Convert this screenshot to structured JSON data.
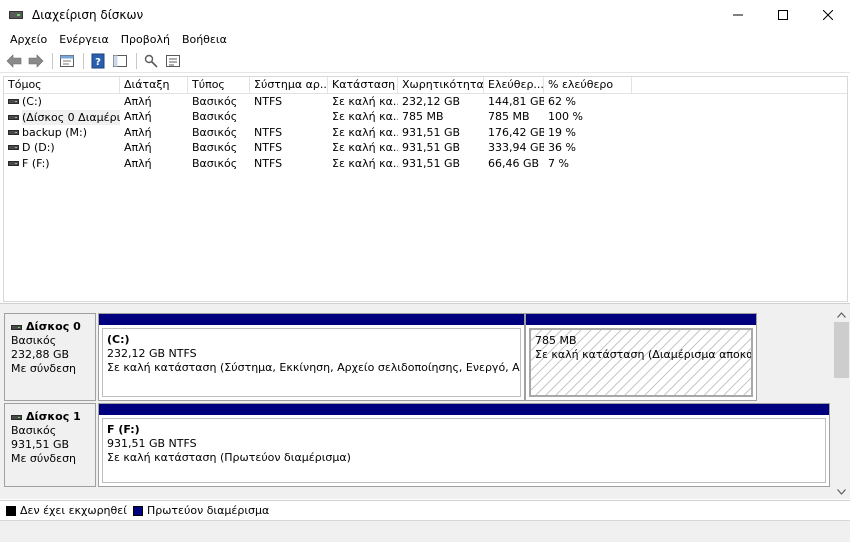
{
  "window": {
    "title": "Διαχείριση δίσκων"
  },
  "menu": [
    "Αρχείο",
    "Ενέργεια",
    "Προβολή",
    "Βοήθεια"
  ],
  "toolbar_icons": [
    "back-arrow-icon",
    "forward-arrow-icon",
    "properties-icon",
    "help-icon",
    "connect-icon",
    "settings-list-icon"
  ],
  "columns": [
    "Τόμος",
    "Διάταξη",
    "Τύπος",
    "Σύστημα αρ...",
    "Κατάσταση",
    "Χωρητικότητα",
    "Ελεύθερ...",
    "% ελεύθερο"
  ],
  "volumes": [
    {
      "name": "(C:)",
      "layout": "Απλή",
      "type": "Βασικός",
      "fs": "NTFS",
      "status": "Σε καλή κα...",
      "capacity": "232,12 GB",
      "free": "144,81 GB",
      "pct": "62 %"
    },
    {
      "name": "(Δίσκος 0 Διαμέρι...",
      "layout": "Απλή",
      "type": "Βασικός",
      "fs": "",
      "status": "Σε καλή κα...",
      "capacity": "785 MB",
      "free": "785 MB",
      "pct": "100 %"
    },
    {
      "name": "backup (M:)",
      "layout": "Απλή",
      "type": "Βασικός",
      "fs": "NTFS",
      "status": "Σε καλή κα...",
      "capacity": "931,51 GB",
      "free": "176,42 GB",
      "pct": "19 %"
    },
    {
      "name": "D (D:)",
      "layout": "Απλή",
      "type": "Βασικός",
      "fs": "NTFS",
      "status": "Σε καλή κα...",
      "capacity": "931,51 GB",
      "free": "333,94 GB",
      "pct": "36 %"
    },
    {
      "name": "F (F:)",
      "layout": "Απλή",
      "type": "Βασικός",
      "fs": "NTFS",
      "status": "Σε καλή κα...",
      "capacity": "931,51 GB",
      "free": "66,46 GB",
      "pct": "7 %"
    }
  ],
  "disks": [
    {
      "name": "Δίσκος 0",
      "type": "Βασικός",
      "size": "232,88 GB",
      "state": "Με σύνδεση",
      "partitions": [
        {
          "name": "(C:)",
          "size": "232,12 GB NTFS",
          "status": "Σε καλή κατάσταση (Σύστημα, Εκκίνηση, Αρχείο σελιδοποίησης, Ενεργό, Αποτύπωση"
        },
        {
          "name": "",
          "size": "785 MB",
          "status": "Σε καλή κατάσταση (Διαμέρισμα αποκατάστα"
        }
      ]
    },
    {
      "name": "Δίσκος 1",
      "type": "Βασικός",
      "size": "931,51 GB",
      "state": "Με σύνδεση",
      "partitions": [
        {
          "name": "F  (F:)",
          "size": "931,51 GB NTFS",
          "status": "Σε καλή κατάσταση (Πρωτεύον διαμέρισμα)"
        }
      ]
    }
  ],
  "legend": [
    {
      "label": "Δεν έχει εκχωρηθεί",
      "color": "#000000"
    },
    {
      "label": "Πρωτεύον διαμέρισμα",
      "color": "#00007f"
    }
  ],
  "colors": {
    "primary_partition": "#00007f",
    "unallocated": "#000000"
  }
}
